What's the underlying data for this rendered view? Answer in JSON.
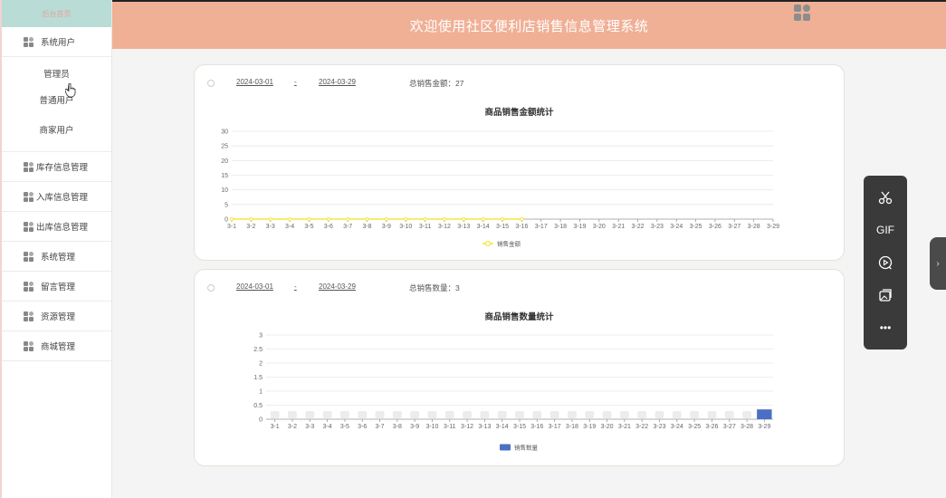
{
  "sidebar": {
    "brand": "后台首页",
    "items": [
      {
        "label": "系统用户",
        "sub": [
          "管理员",
          "普通用户",
          "商家用户"
        ]
      },
      {
        "label": "库存信息管理"
      },
      {
        "label": "入库信息管理"
      },
      {
        "label": "出库信息管理"
      },
      {
        "label": "系统管理"
      },
      {
        "label": "留言管理"
      },
      {
        "label": "资源管理"
      },
      {
        "label": "商城管理"
      }
    ]
  },
  "header": {
    "title": "欢迎使用社区便利店销售信息管理系统"
  },
  "panels": [
    {
      "date_start": "2024-03-01",
      "date_sep": "-",
      "date_end": "2024-03-29",
      "total_label": "总销售金额：27",
      "chart_title": "商品销售金额统计",
      "legend": "销售金额"
    },
    {
      "date_start": "2024-03-01",
      "date_sep": "-",
      "date_end": "2024-03-29",
      "total_label": "总销售数量：3",
      "chart_title": "商品销售数量统计",
      "legend": "销售数量"
    }
  ],
  "chart_data": [
    {
      "type": "line",
      "title": "商品销售金额统计",
      "categories": [
        "3-1",
        "3-2",
        "3-3",
        "3-4",
        "3-5",
        "3-6",
        "3-7",
        "3-8",
        "3-9",
        "3-10",
        "3-11",
        "3-12",
        "3-13",
        "3-14",
        "3-15",
        "3-16",
        "3-17",
        "3-18",
        "3-19",
        "3-20",
        "3-21",
        "3-22",
        "3-23",
        "3-24",
        "3-25",
        "3-26",
        "3-27",
        "3-28",
        "3-29"
      ],
      "series": [
        {
          "name": "销售金额",
          "values": [
            0,
            0,
            0,
            0,
            0,
            0,
            0,
            0,
            0,
            0,
            0,
            0,
            0,
            0,
            0,
            0
          ]
        }
      ],
      "ylim": [
        0,
        30
      ],
      "yticks": [
        0,
        5,
        10,
        15,
        20,
        25,
        30
      ],
      "color": "#f5e63b",
      "legend_position": "bottom"
    },
    {
      "type": "bar",
      "title": "商品销售数量统计",
      "categories": [
        "3-1",
        "3-2",
        "3-3",
        "3-4",
        "3-5",
        "3-6",
        "3-7",
        "3-8",
        "3-9",
        "3-10",
        "3-11",
        "3-12",
        "3-13",
        "3-14",
        "3-15",
        "3-16",
        "3-17",
        "3-18",
        "3-19",
        "3-20",
        "3-21",
        "3-22",
        "3-23",
        "3-24",
        "3-25",
        "3-26",
        "3-27",
        "3-28",
        "3-29"
      ],
      "series": [
        {
          "name": "销售数量",
          "values": [
            0,
            0,
            0,
            0,
            0,
            0,
            0,
            0,
            0,
            0,
            0,
            0,
            0,
            0,
            0,
            0,
            0,
            0,
            0,
            0,
            0,
            0,
            0,
            0,
            0,
            0,
            0,
            0,
            0.35
          ]
        }
      ],
      "ylim": [
        0,
        3
      ],
      "yticks": [
        0,
        0.5,
        1,
        1.5,
        2,
        2.5,
        3
      ],
      "color": "#4a6fc4",
      "legend_position": "bottom"
    }
  ],
  "toolbar": {
    "tools": [
      "scissors-icon",
      "GIF",
      "record-icon",
      "image-icon",
      "more-icon"
    ],
    "gif_label": "GIF",
    "more_label": "•••",
    "side_tab": "›"
  }
}
